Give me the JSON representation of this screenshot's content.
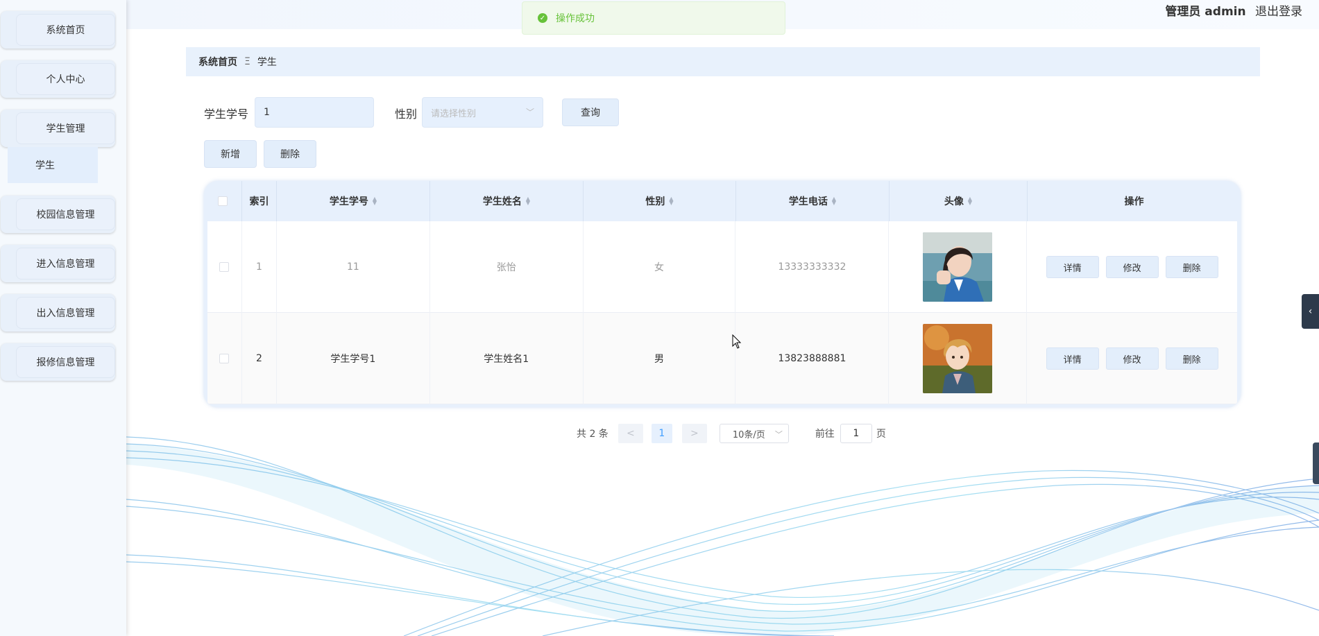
{
  "header": {
    "role": "管理员",
    "username": "admin",
    "logout_label": "退出登录"
  },
  "toast": {
    "message": "操作成功"
  },
  "sidebar": {
    "items": [
      {
        "label": "系统首页"
      },
      {
        "label": "个人中心"
      },
      {
        "label": "学生管理"
      },
      {
        "label": "校园信息管理"
      },
      {
        "label": "进入信息管理"
      },
      {
        "label": "出入信息管理"
      },
      {
        "label": "报修信息管理"
      }
    ],
    "submenu_active": "学生"
  },
  "breadcrumb": {
    "home": "系统首页",
    "separator": "Ξ",
    "current": "学生"
  },
  "search": {
    "student_id_label": "学生学号",
    "student_id_value": "1",
    "gender_label": "性别",
    "gender_placeholder": "请选择性别",
    "query_button": "查询"
  },
  "actions": {
    "add_button": "新增",
    "delete_button": "删除"
  },
  "table": {
    "columns": [
      "索引",
      "学生学号",
      "学生姓名",
      "性别",
      "学生电话",
      "头像",
      "操作"
    ],
    "rows": [
      {
        "index": "1",
        "student_id": "11",
        "name": "张怡",
        "gender": "女",
        "phone": "13333333332"
      },
      {
        "index": "2",
        "student_id": "学生学号1",
        "name": "学生姓名1",
        "gender": "男",
        "phone": "13823888881"
      }
    ],
    "row_actions": {
      "detail": "详情",
      "edit": "修改",
      "delete": "删除"
    }
  },
  "pagination": {
    "total_text": "共 2 条",
    "prev": "<",
    "current_page": "1",
    "next": ">",
    "page_size": "10条/页",
    "goto_label": "前往",
    "goto_value": "1",
    "page_word": "页"
  },
  "colors": {
    "accent": "#409eff",
    "success": "#67c23a",
    "panel": "#e7f0fc"
  }
}
